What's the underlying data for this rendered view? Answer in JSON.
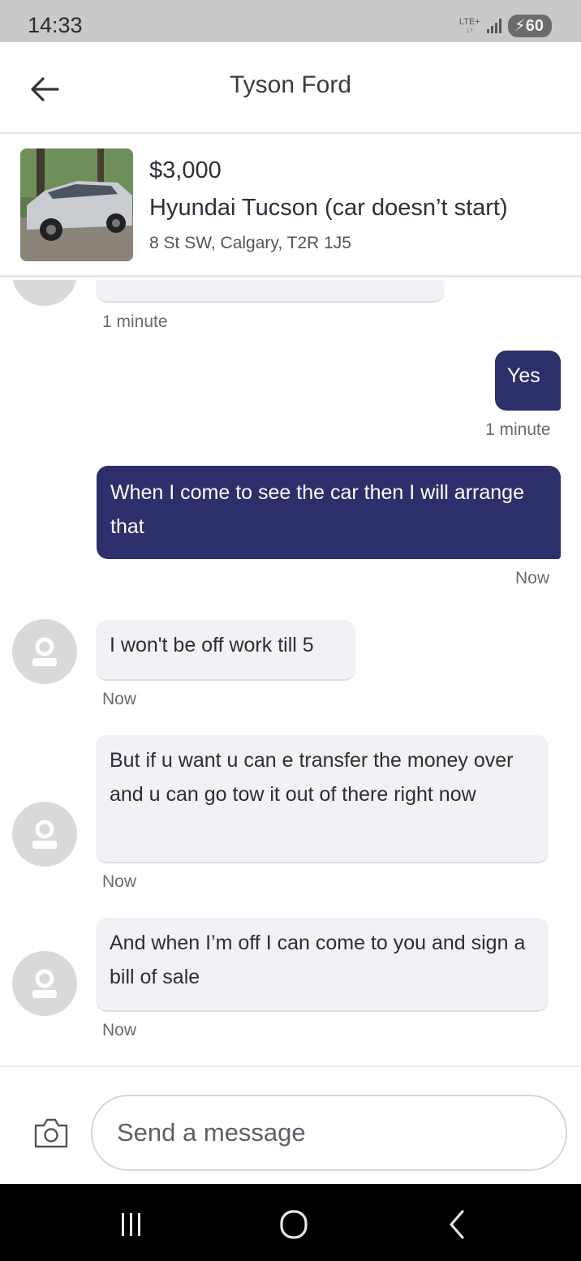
{
  "status_bar": {
    "time": "14:33",
    "network_label": "LTE+",
    "battery_level": "60"
  },
  "header": {
    "title": "Tyson Ford",
    "back_icon": "arrow-left-icon"
  },
  "listing": {
    "price": "$3,000",
    "title": "Hyundai Tucson (car doesn’t start)",
    "location": "8 St SW, Calgary, T2R 1J5"
  },
  "messages": [
    {
      "direction": "incoming",
      "text": "",
      "time": "1 minute"
    },
    {
      "direction": "outgoing",
      "text": "Yes",
      "time": "1 minute"
    },
    {
      "direction": "outgoing",
      "text": "When I come to see the car then I will arrange that",
      "time": "Now"
    },
    {
      "direction": "incoming",
      "text": "I won't be off work till 5",
      "time": "Now"
    },
    {
      "direction": "incoming",
      "text": "But if u want u can e transfer the money over and u can go tow it out of there right now",
      "time": "Now"
    },
    {
      "direction": "incoming",
      "text": "And when I’m off I can come to you and sign a bill of sale",
      "time": "Now"
    }
  ],
  "composer": {
    "placeholder": "Send a message",
    "camera_icon": "camera-icon"
  },
  "nav_bar": {
    "recents_icon": "recents-icon",
    "home_icon": "home-icon",
    "back_icon": "nav-back-icon"
  },
  "colors": {
    "outgoing_bubble": "#2c2f6a",
    "incoming_bubble": "#f1f1f6",
    "status_bar": "#c9c9c9",
    "nav_bar": "#000000"
  }
}
